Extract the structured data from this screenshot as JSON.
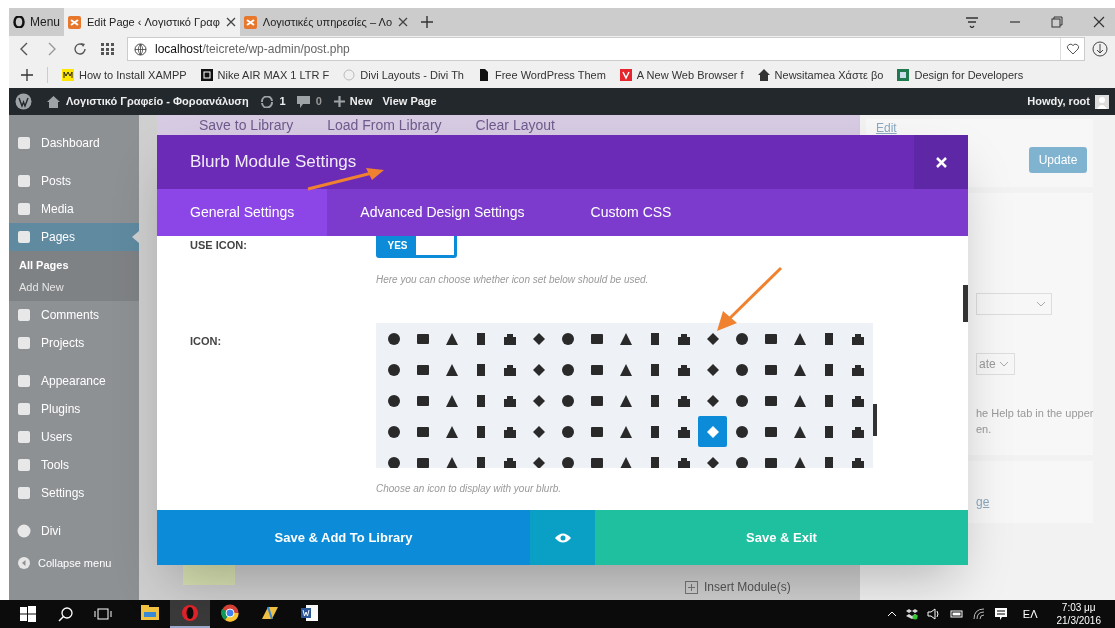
{
  "browser": {
    "menu_label": "Menu",
    "tabs": [
      {
        "title": "Edit Page ‹ Λογιστικό Γραφ",
        "selected": true
      },
      {
        "title": "Λογιστικές υπηρεσίες – Λο",
        "selected": false
      }
    ],
    "address": {
      "host": "localhost",
      "path": "/teicrete/wp-admin/post.php"
    },
    "bookmarks": [
      {
        "label": "How to Install XAMPP"
      },
      {
        "label": "Nike AIR MAX 1 LTR F"
      },
      {
        "label": "Divi Layouts - Divi Th"
      },
      {
        "label": "Free WordPress Them"
      },
      {
        "label": "A New Web Browser f"
      },
      {
        "label": "Newsitamea Χάστε βο"
      },
      {
        "label": "Design for Developers"
      }
    ]
  },
  "admin_bar": {
    "site_name": "Λογιστικό Γραφείο - Φοροανάλυση",
    "updates": "1",
    "comments": "0",
    "new_label": "New",
    "view_label": "View Page",
    "greeting": "Howdy, root"
  },
  "sidebar": {
    "items": [
      {
        "label": "Dashboard",
        "selected": false
      },
      {
        "label": "Posts",
        "selected": false
      },
      {
        "label": "Media",
        "selected": false
      },
      {
        "label": "Pages",
        "selected": true,
        "children": [
          {
            "label": "All Pages",
            "selected": true
          },
          {
            "label": "Add New",
            "selected": false
          }
        ]
      },
      {
        "label": "Comments",
        "selected": false
      },
      {
        "label": "Projects",
        "selected": false
      },
      {
        "label": "Appearance",
        "selected": false
      },
      {
        "label": "Plugins",
        "selected": false
      },
      {
        "label": "Users",
        "selected": false
      },
      {
        "label": "Tools",
        "selected": false
      },
      {
        "label": "Settings",
        "selected": false
      },
      {
        "label": "Divi",
        "selected": false
      }
    ],
    "collapse_label": "Collapse menu"
  },
  "builder_toolbar": [
    "Save to Library",
    "Load From Library",
    "Clear Layout"
  ],
  "background": {
    "edit_link": "Edit",
    "update_button": "Update",
    "select_value": "ate",
    "help_text": "he Help tab in the upper",
    "help_text_2": "en.",
    "link": "ge",
    "insert_label": "Insert Module(s)"
  },
  "modal": {
    "title": "Blurb Module Settings",
    "tabs": [
      {
        "label": "General Settings",
        "selected": true
      },
      {
        "label": "Advanced Design Settings",
        "selected": false
      },
      {
        "label": "Custom CSS",
        "selected": false
      }
    ],
    "use_icon": {
      "label": "USE ICON:",
      "value_label": "YES",
      "on": true,
      "hint": "Here you can choose whether icon set below should be used."
    },
    "icon": {
      "label": "ICON:",
      "hint": "Choose an icon to display with your blurb.",
      "icons": [
        {
          "selected": false
        },
        {
          "selected": false
        },
        {
          "selected": false
        },
        {
          "selected": false
        },
        {
          "selected": false
        },
        {
          "selected": false
        },
        {
          "selected": false
        },
        {
          "selected": false
        },
        {
          "selected": false
        },
        {
          "selected": false
        },
        {
          "selected": false
        },
        {
          "selected": false
        },
        {
          "selected": false
        },
        {
          "selected": false
        },
        {
          "selected": false
        },
        {
          "selected": false
        },
        {
          "selected": false
        },
        {
          "selected": false
        },
        {
          "selected": false
        },
        {
          "selected": false
        },
        {
          "selected": false
        },
        {
          "selected": false
        },
        {
          "selected": false
        },
        {
          "selected": false
        },
        {
          "selected": false
        },
        {
          "selected": false
        },
        {
          "selected": false
        },
        {
          "selected": false
        },
        {
          "selected": false
        },
        {
          "selected": false
        },
        {
          "selected": false
        },
        {
          "selected": false
        },
        {
          "selected": false
        },
        {
          "selected": false
        },
        {
          "selected": false
        },
        {
          "selected": false
        },
        {
          "selected": false
        },
        {
          "selected": false
        },
        {
          "selected": false
        },
        {
          "selected": false
        },
        {
          "selected": false
        },
        {
          "selected": false
        },
        {
          "selected": false
        },
        {
          "selected": false
        },
        {
          "selected": false
        },
        {
          "selected": false
        },
        {
          "selected": false
        },
        {
          "selected": false
        },
        {
          "selected": false
        },
        {
          "selected": false
        },
        {
          "selected": false
        },
        {
          "selected": false
        },
        {
          "selected": false
        },
        {
          "selected": false
        },
        {
          "selected": false
        },
        {
          "selected": false
        },
        {
          "selected": false
        },
        {
          "selected": false
        },
        {
          "selected": false
        },
        {
          "selected": false
        },
        {
          "selected": false
        },
        {
          "selected": false
        },
        {
          "selected": true
        },
        {
          "selected": false
        },
        {
          "selected": false
        },
        {
          "selected": false
        },
        {
          "selected": false
        },
        {
          "selected": false
        },
        {
          "selected": false
        },
        {
          "selected": false
        },
        {
          "selected": false
        },
        {
          "selected": false
        },
        {
          "selected": false
        },
        {
          "selected": false
        },
        {
          "selected": false
        },
        {
          "selected": false
        },
        {
          "selected": false
        },
        {
          "selected": false
        },
        {
          "selected": false
        },
        {
          "selected": false
        },
        {
          "selected": false
        },
        {
          "selected": false
        },
        {
          "selected": false
        },
        {
          "selected": false
        },
        {
          "selected": false
        }
      ]
    },
    "footer": {
      "save_library": "Save & Add To Library",
      "save_exit": "Save & Exit"
    }
  },
  "taskbar": {
    "apps": [
      {
        "selected": false
      },
      {
        "selected": true
      },
      {
        "selected": false
      },
      {
        "selected": false
      },
      {
        "selected": false
      }
    ],
    "language": "EΛ",
    "time": "7:03 μμ",
    "date": "21/3/2016"
  }
}
